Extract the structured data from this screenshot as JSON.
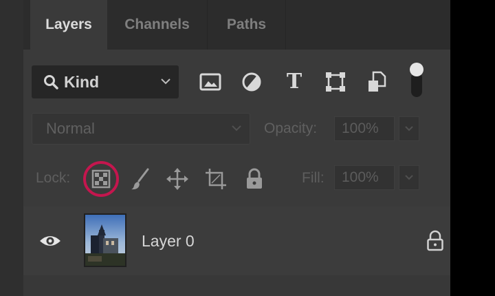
{
  "tabs": [
    {
      "label": "Layers",
      "active": true
    },
    {
      "label": "Channels",
      "active": false
    },
    {
      "label": "Paths",
      "active": false
    }
  ],
  "filter": {
    "kind_label": "Kind",
    "icons": [
      "image-filter-icon",
      "adjustment-filter-icon",
      "type-filter-icon",
      "shape-filter-icon",
      "smart-object-filter-icon",
      "filter-toggle-switch"
    ],
    "type_glyph": "T"
  },
  "blend": {
    "mode": "Normal",
    "opacity_label": "Opacity:",
    "opacity_value": "100%"
  },
  "lock": {
    "label": "Lock:",
    "fill_label": "Fill:",
    "fill_value": "100%",
    "highlight_color": "#c4164e"
  },
  "layers": [
    {
      "name": "Layer 0",
      "visible": true,
      "locked": true
    }
  ],
  "colors": {
    "panel_bg": "#3a3a3a",
    "tabbar_bg": "#2c2c2c",
    "active_text": "#dcdcdc",
    "inactive_text": "#7f7f7f"
  }
}
